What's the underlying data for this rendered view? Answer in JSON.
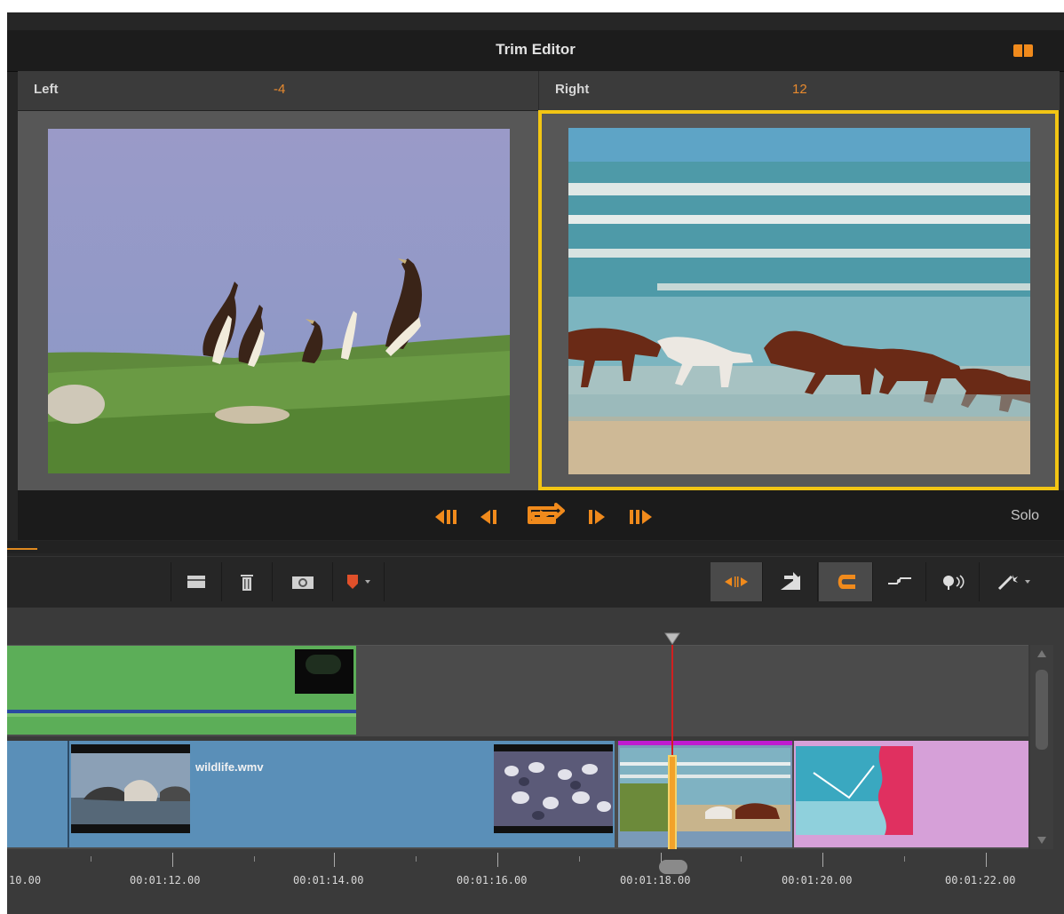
{
  "window": {
    "title": "Trim Editor"
  },
  "header": {
    "left": {
      "label": "Left",
      "value": "-4"
    },
    "right": {
      "label": "Right",
      "value": "12"
    }
  },
  "transport": {
    "solo_label": "Solo",
    "buttons": [
      "jump-to-start-icon",
      "step-back-icon",
      "loop-play-icon",
      "step-forward-icon",
      "jump-to-end-icon"
    ]
  },
  "toolbar": {
    "left_tools": [
      "storyboard-icon",
      "trash-icon",
      "snapshot-camera-icon",
      "marker-icon"
    ],
    "right_tools": [
      "trim-mode-icon",
      "insert-mode-icon",
      "magnet-snap-icon",
      "dynamic-length-icon",
      "audio-scrub-icon",
      "effects-wand-icon"
    ]
  },
  "timeline": {
    "clip_name": "wildlife.wmv",
    "ruler_labels": [
      "10.00",
      "00:01:12.00",
      "00:01:14.00",
      "00:01:16.00",
      "00:01:18.00",
      "00:01:20.00",
      "00:01:22.00"
    ]
  },
  "colors": {
    "accent": "#f08a1c",
    "selection_border": "#f2c514",
    "playhead": "#d02020",
    "clip_blue": "#5a8fb8",
    "clip_green": "#5cae58",
    "clip_pink": "#d6a0d8",
    "transition_magenta": "#c01ad0"
  }
}
